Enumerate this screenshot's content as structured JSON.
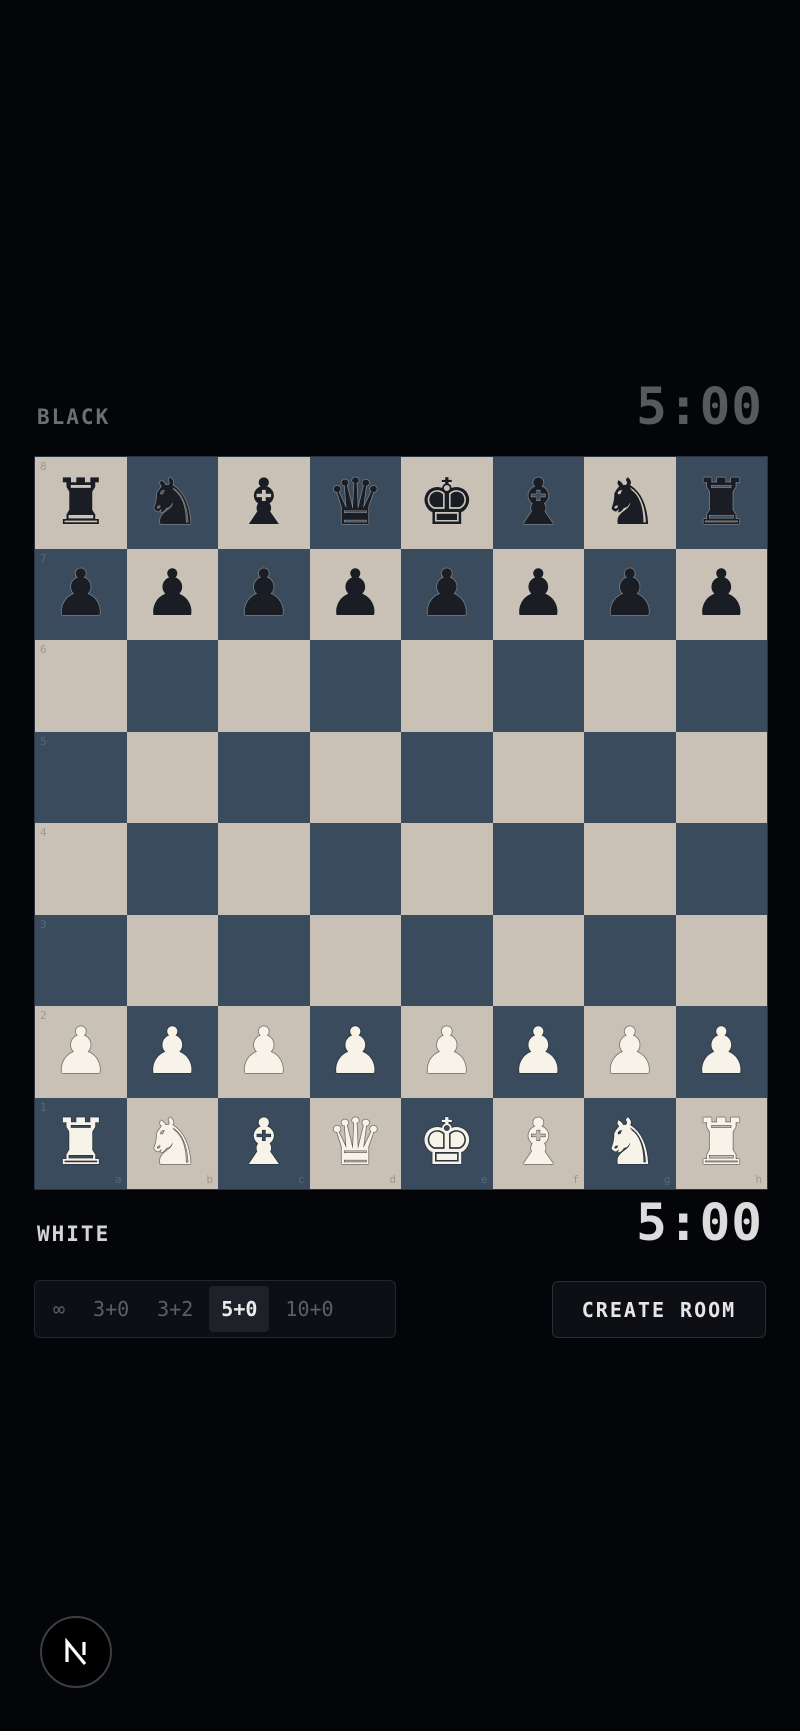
{
  "players": {
    "top": {
      "label": "BLACK",
      "clock": "5:00"
    },
    "bottom": {
      "label": "WHITE",
      "clock": "5:00"
    }
  },
  "board": {
    "files": [
      "a",
      "b",
      "c",
      "d",
      "e",
      "f",
      "g",
      "h"
    ],
    "ranks": [
      "8",
      "7",
      "6",
      "5",
      "4",
      "3",
      "2",
      "1"
    ],
    "light_color": "#c9c1b5",
    "dark_color": "#3a4b5e",
    "position": [
      [
        "br",
        "bn",
        "bb",
        "bq",
        "bk",
        "bb",
        "bn",
        "br"
      ],
      [
        "bp",
        "bp",
        "bp",
        "bp",
        "bp",
        "bp",
        "bp",
        "bp"
      ],
      [
        "",
        "",
        "",
        "",
        "",
        "",
        "",
        ""
      ],
      [
        "",
        "",
        "",
        "",
        "",
        "",
        "",
        ""
      ],
      [
        "",
        "",
        "",
        "",
        "",
        "",
        "",
        ""
      ],
      [
        "",
        "",
        "",
        "",
        "",
        "",
        "",
        ""
      ],
      [
        "wp",
        "wp",
        "wp",
        "wp",
        "wp",
        "wp",
        "wp",
        "wp"
      ],
      [
        "wr",
        "wn",
        "wb",
        "wq",
        "wk",
        "wb",
        "wn",
        "wr"
      ]
    ]
  },
  "time_controls": {
    "options": [
      "∞",
      "3+0",
      "3+2",
      "5+0",
      "10+0"
    ],
    "selected": "5+0"
  },
  "actions": {
    "create_room": "CREATE ROOM"
  },
  "badge": {
    "icon": "next-logo-icon"
  }
}
